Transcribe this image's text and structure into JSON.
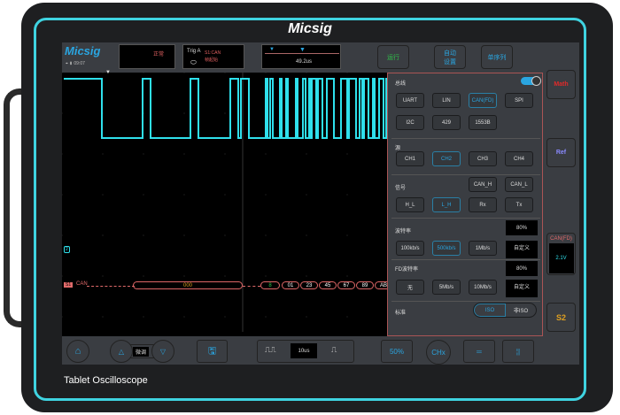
{
  "device": {
    "brand": "Micsig",
    "model": "Tablet Oscilloscope"
  },
  "topbar": {
    "logo": "Micsig",
    "time": "09:07",
    "status": "正常",
    "trig_label": "Trig A",
    "trig_source": "S1:CAN",
    "trig_type": "帧起始",
    "timebase_pos": "49.2us",
    "run": "运行",
    "auto_line1": "自动",
    "auto_line2": "设置",
    "single": "单序列"
  },
  "panel": {
    "bus_title": "总线",
    "bus_enabled": true,
    "bus_types": [
      "UART",
      "LIN",
      "CAN(FD)",
      "SPI",
      "I2C",
      "429",
      "1553B"
    ],
    "bus_selected": "CAN(FD)",
    "source_title": "源",
    "sources": [
      "CH1",
      "CH2",
      "CH3",
      "CH4"
    ],
    "source_selected": "CH2",
    "signal_title": "信号",
    "signal_top": [
      "CAN_H",
      "CAN_L"
    ],
    "signals": [
      "H_L",
      "L_H",
      "Rx",
      "Tx"
    ],
    "signal_selected": "L_H",
    "baud_title": "波特率",
    "baud_sample": "80%",
    "bauds": [
      "100kb/s",
      "500kb/s",
      "1Mb/s"
    ],
    "baud_selected": "500kb/s",
    "baud_custom": "自定义",
    "fd_title": "FD波特率",
    "fd_sample": "80%",
    "fd_bauds": [
      "无",
      "5Mb/s",
      "10Mb/s"
    ],
    "fd_custom": "自定义",
    "std_title": "标准",
    "std_options": [
      "ISO",
      "非ISO"
    ],
    "std_selected": "ISO"
  },
  "right": {
    "math": "Math",
    "ref": "Ref",
    "bus_label": "CAN(FD)",
    "bus_level": "2.1V",
    "s2": "S2"
  },
  "decode": {
    "marker": "S1",
    "label": "CAN",
    "id": "000",
    "dlc": "8",
    "bytes": [
      "01",
      "23",
      "45",
      "67",
      "89",
      "AB"
    ]
  },
  "channel_marker": "2",
  "bottom": {
    "fine": "微调",
    "timebase": "10us",
    "fifty": "50%",
    "chx": "CHx"
  },
  "colors": {
    "trace": "#2fe0ec",
    "decode": "#e06a6a",
    "accent": "#2aa5e0",
    "run": "#2fc24a",
    "math": "#e02a2a",
    "ref": "#8a8aff",
    "s2": "#e0a020"
  }
}
